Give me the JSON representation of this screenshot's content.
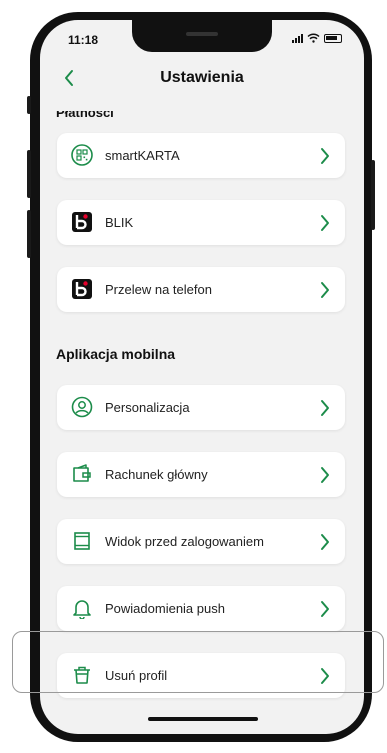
{
  "status": {
    "time": "11:18"
  },
  "header": {
    "title": "Ustawienia"
  },
  "sections": {
    "payments_cut": "Płatności",
    "mobile_app": "Aplikacja mobilna"
  },
  "items": {
    "smartkarta": "smartKARTA",
    "blik": "BLIK",
    "przelew": "Przelew na telefon",
    "personalizacja": "Personalizacja",
    "rachunek": "Rachunek główny",
    "widok": "Widok przed zalogowaniem",
    "powiadomienia": "Powiadomienia push",
    "usun": "Usuń profil"
  },
  "colors": {
    "accent": "#1c8c4a",
    "blik_bg": "#111111",
    "blik_dot": "#e4002b"
  },
  "icons": {
    "smartkarta": "qr-code-icon",
    "blik": "blik-logo-icon",
    "przelew": "blik-logo-icon",
    "personalizacja": "user-circle-icon",
    "rachunek": "wallet-icon",
    "widok": "screen-icon",
    "powiadomienia": "bell-icon",
    "usun": "trash-icon"
  }
}
